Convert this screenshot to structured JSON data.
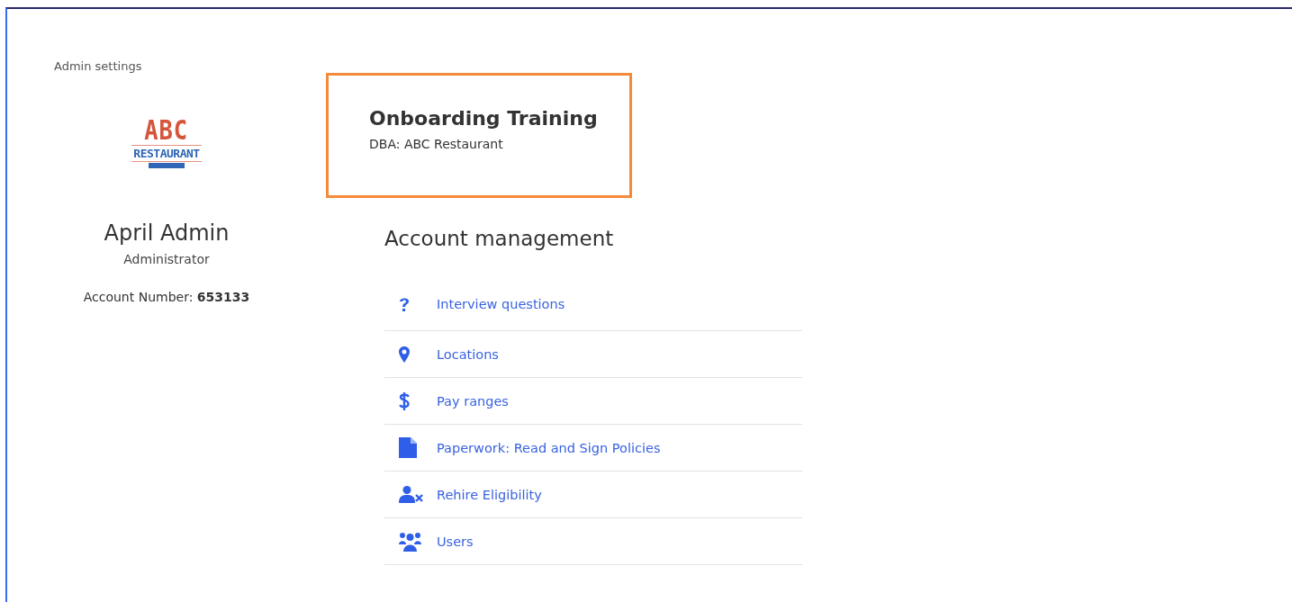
{
  "breadcrumb": "Admin settings",
  "logo": {
    "top": "ABC",
    "bottom": "RESTAURANT"
  },
  "profile": {
    "name": "April Admin",
    "role": "Administrator",
    "account_label": "Account Number:",
    "account_number": "653133"
  },
  "company": {
    "title": "Onboarding Training",
    "subtitle": "DBA: ABC Restaurant"
  },
  "section_title": "Account management",
  "links": [
    {
      "label": "Interview questions",
      "kind": "question"
    },
    {
      "label": "Locations",
      "kind": "pin"
    },
    {
      "label": "Pay ranges",
      "kind": "dollar"
    },
    {
      "label": "Paperwork: Read and Sign Policies",
      "kind": "file"
    },
    {
      "label": "Rehire Eligibility",
      "kind": "userx"
    },
    {
      "label": "Users",
      "kind": "users"
    }
  ]
}
